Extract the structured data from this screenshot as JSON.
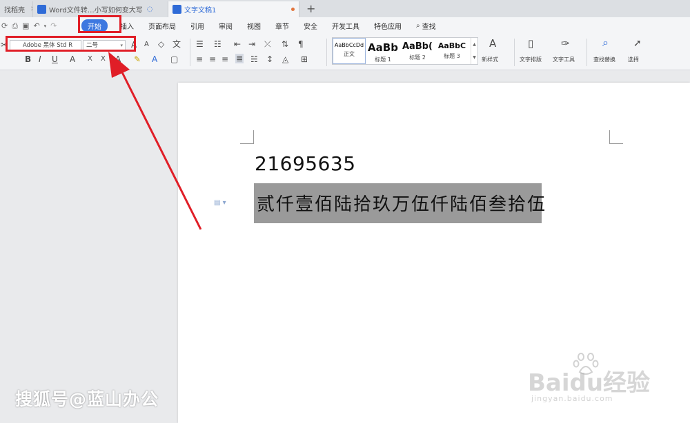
{
  "tabs": [
    {
      "label": "找稻壳",
      "active": false,
      "close": "✕",
      "icon_color": ""
    },
    {
      "label": "Word文件转…小写如何变大写",
      "active": false,
      "close": "",
      "icon_color": "#2f6bd7"
    },
    {
      "label": "文字文稿1",
      "active": true,
      "close": "",
      "icon_color": "#2f6bd7"
    }
  ],
  "new_tab_label": "+",
  "menu": {
    "items": [
      "开始",
      "插入",
      "页面布局",
      "引用",
      "审阅",
      "视图",
      "章节",
      "安全",
      "开发工具",
      "特色应用"
    ],
    "active_index": 0,
    "search_label": "查找"
  },
  "ribbon": {
    "font_name": "Adobe 黑体 Std R",
    "font_size": "二号",
    "styles": [
      {
        "sample": "AaBbCcDd",
        "name": "正文"
      },
      {
        "sample": "AaBb",
        "name": "标题 1"
      },
      {
        "sample": "AaBb(",
        "name": "标题 2"
      },
      {
        "sample": "AaBbC",
        "name": "标题 3"
      }
    ],
    "right_buttons": [
      "新样式",
      "文字排版",
      "文字工具",
      "查找替换",
      "选择"
    ]
  },
  "document": {
    "number_line": "21695635",
    "chinese_line": "贰仟壹佰陆拾玖万伍仟陆佰叁拾伍"
  },
  "watermarks": {
    "left": "搜狐号@蓝山办公",
    "baidu": "Baidu经验",
    "baidu_sub": "jingyan.baidu.com"
  },
  "colors": {
    "accent": "#3d78e0",
    "highlight_red": "#e01e27",
    "selection_gray": "#9a9a9a"
  }
}
